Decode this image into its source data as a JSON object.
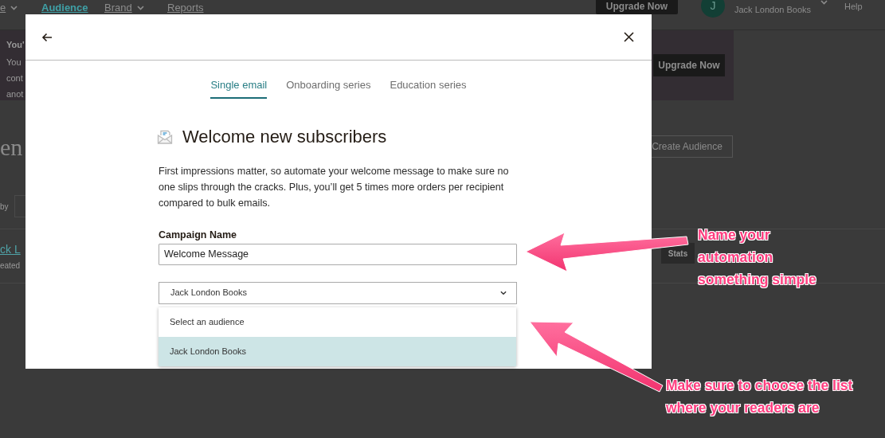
{
  "background_page": {
    "nav": {
      "items": [
        {
          "label": "e",
          "dropdown": true,
          "selected": false
        },
        {
          "label": "Audience",
          "dropdown": false,
          "selected": true
        },
        {
          "label": "Brand",
          "dropdown": true,
          "selected": false
        },
        {
          "label": "Reports",
          "dropdown": false,
          "selected": false
        }
      ],
      "upgrade_button": "Upgrade Now",
      "account": {
        "avatar": "J",
        "name": "Jack London Books"
      },
      "help": "Help"
    },
    "banner": {
      "title": "You'",
      "lines": [
        "You",
        "cont",
        "anot"
      ],
      "button": "Upgrade Now"
    },
    "heading": "en",
    "create_button": "Create Audience",
    "filter_label": "by",
    "audience_row": {
      "name": "ck L",
      "meta": "eated",
      "button": "Stats"
    }
  },
  "modal": {
    "tabs": [
      {
        "label": "Single email",
        "selected": true
      },
      {
        "label": "Onboarding series",
        "selected": false
      },
      {
        "label": "Education series",
        "selected": false
      }
    ],
    "title": "Welcome new subscribers",
    "description": "First impressions matter, so automate your welcome message to make sure no one slips through the cracks. Plus, you’ll get 5 times more orders per recipient compared to bulk emails.",
    "campaign_name": {
      "label": "Campaign Name",
      "value": "Welcome Message"
    },
    "audience_select": {
      "value": "Jack London Books",
      "expanded": true,
      "options": [
        {
          "label": "Select an audience",
          "selected": false
        },
        {
          "label": "Jack London Books",
          "selected": true
        }
      ]
    }
  },
  "annotations": [
    {
      "lines": [
        "Name your",
        "automation",
        "something simple"
      ]
    },
    {
      "lines": [
        "Make sure to choose the list",
        "where your readers are"
      ]
    }
  ]
}
